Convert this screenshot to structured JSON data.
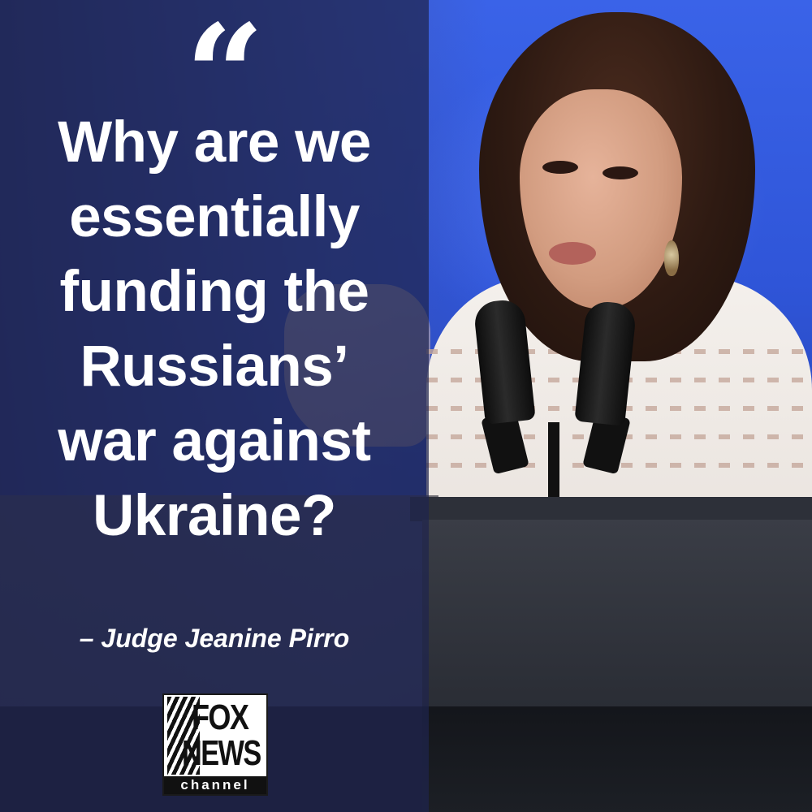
{
  "quote": {
    "mark": "“",
    "lines": [
      "Why are we",
      "essentially",
      "funding the",
      "Russians’",
      "war against",
      "Ukraine?"
    ],
    "attribution": "– Judge Jeanine Pirro"
  },
  "logo": {
    "word1": "FOX",
    "word2": "NEWS",
    "word3": "channel"
  },
  "colors": {
    "panel_overlay": "#1e244e",
    "background_blue": "#2f55d8",
    "text": "#ffffff"
  },
  "icons": {
    "quote_mark": "quote-mark-icon",
    "logo": "fox-news-logo"
  }
}
